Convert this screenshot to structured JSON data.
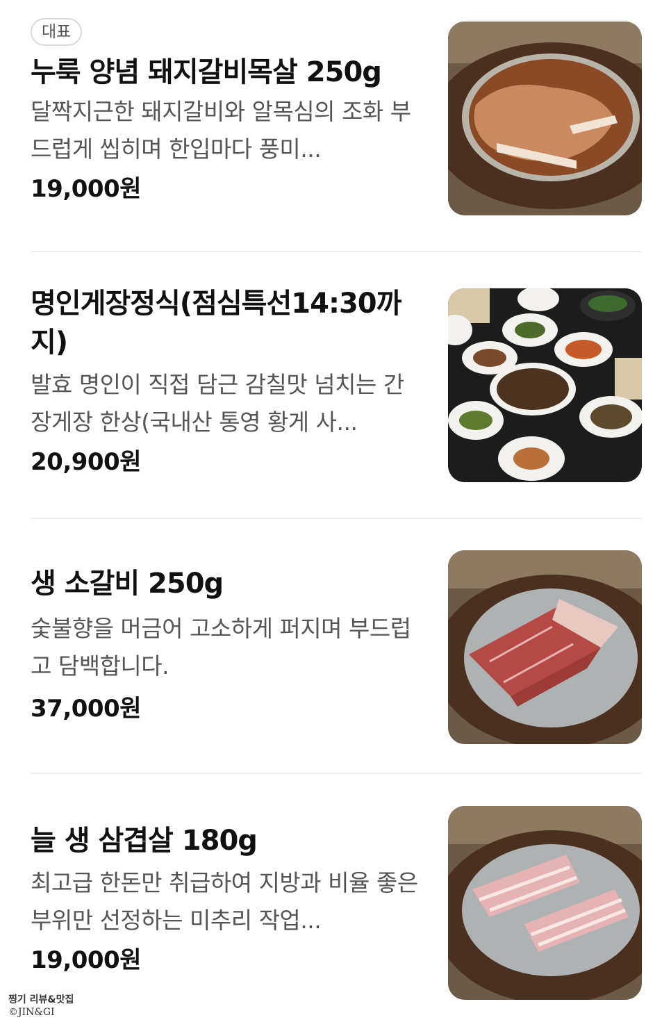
{
  "menu": {
    "items": [
      {
        "badge": "대표",
        "name": "누룩 양념 돼지갈비목살 250g",
        "description": "달짝지근한 돼지갈비와 알목심의 조화 부드럽게 씹히며 한입마다 풍미...",
        "price": "19,000원",
        "image": "marinated-pork-rib-plate"
      },
      {
        "name": "명인게장정식(점심특선14:30까지)",
        "description": "발효 명인이 직접 담근 감칠맛 넘치는 간장게장 한상(국내산 통영 황게 사...",
        "price": "20,900원",
        "image": "soy-crab-set-meal"
      },
      {
        "name": "생 소갈비 250g",
        "description": "숯불향을 머금어 고소하게 퍼지며 부드럽고 담백합니다.",
        "price": "37,000원",
        "image": "raw-beef-rib-plate"
      },
      {
        "name": "늘 생 삼겹살 180g",
        "description": "최고급 한돈만 취급하여 지방과 비율 좋은 부위만 선정하는 미추리 작업...",
        "price": "19,000원",
        "image": "raw-pork-belly-plate"
      }
    ]
  },
  "watermark": {
    "line1": "찡기 리뷰&맛집",
    "line2": "©JIN&GI"
  },
  "colors": {
    "text_primary": "#111111",
    "text_secondary": "#555555",
    "divider": "#eeeeee",
    "badge_border": "#d9d9d9"
  }
}
